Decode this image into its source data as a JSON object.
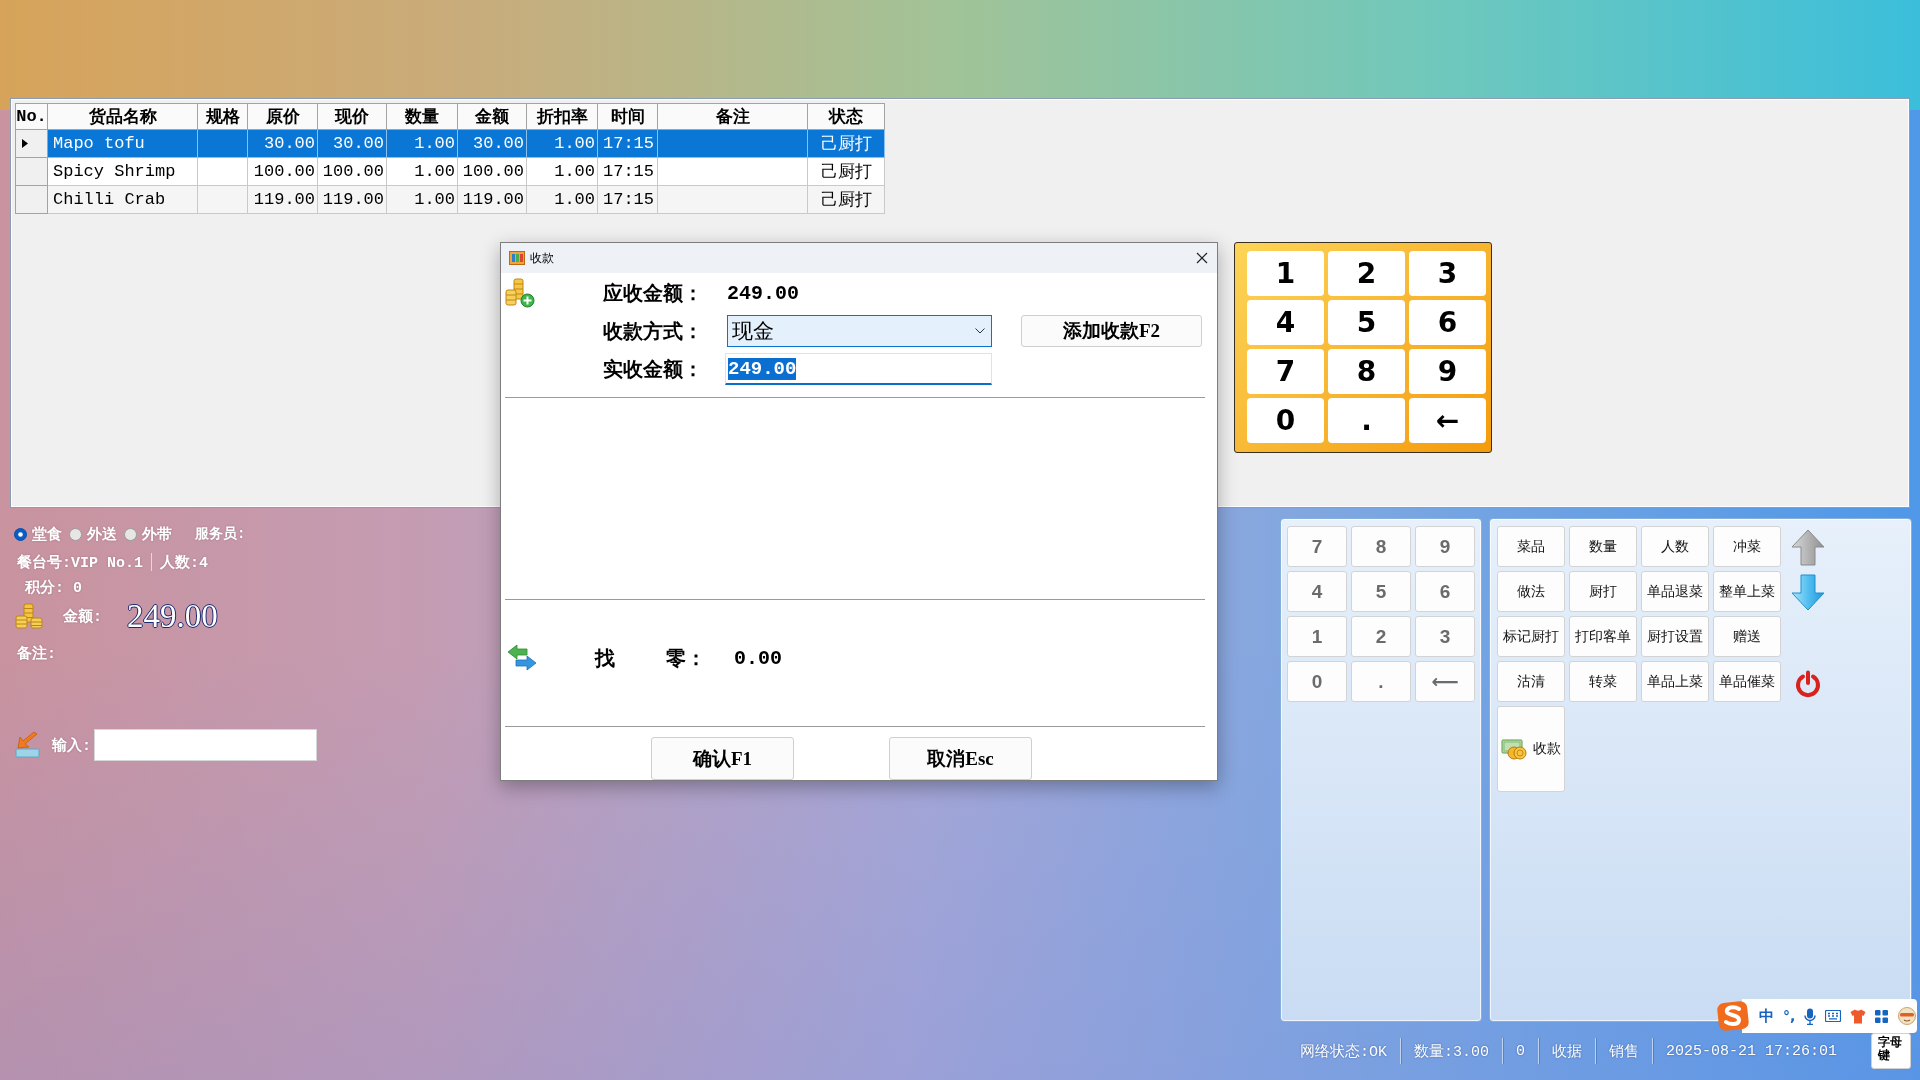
{
  "order_table": {
    "columns": [
      "No.",
      "货品名称",
      "规格",
      "原价",
      "现价",
      "数量",
      "金额",
      "折扣率",
      "时间",
      "备注",
      "状态"
    ],
    "rows": [
      {
        "selected": true,
        "name": "Mapo tofu",
        "original_price": "30.00",
        "current_price": "30.00",
        "quantity": "1.00",
        "amount": "30.00",
        "discount_rate": "1.00",
        "time": "17:15",
        "status": "己厨打"
      },
      {
        "selected": false,
        "name": "Spicy Shrimp",
        "original_price": "100.00",
        "current_price": "100.00",
        "quantity": "1.00",
        "amount": "100.00",
        "discount_rate": "1.00",
        "time": "17:15",
        "status": "己厨打"
      },
      {
        "selected": false,
        "name": "Chilli Crab",
        "original_price": "119.00",
        "current_price": "119.00",
        "quantity": "1.00",
        "amount": "119.00",
        "discount_rate": "1.00",
        "time": "17:15",
        "status": "己厨打"
      }
    ]
  },
  "payment_dialog": {
    "title": "收款",
    "amount_due": {
      "label": "应收金额：",
      "value": "249.00"
    },
    "payment_method": {
      "label": "收款方式：",
      "value": "现金"
    },
    "add_payment_button": "添加收款F2",
    "amount_received": {
      "label": "实收金额：",
      "value": "249.00",
      "text_selected": true
    },
    "change": {
      "label_parts": [
        "找",
        "零："
      ],
      "value": "0.00"
    },
    "buttons": [
      "确认F1",
      "取消Esc"
    ]
  },
  "quick_keypad": {
    "keys": [
      "1",
      "2",
      "3",
      "4",
      "5",
      "6",
      "7",
      "8",
      "9",
      "0",
      ".",
      "←"
    ]
  },
  "order_info": {
    "order_types": [
      {
        "label": "堂食",
        "selected": true
      },
      {
        "label": "外送",
        "selected": false
      },
      {
        "label": "外带",
        "selected": false
      }
    ],
    "waiter_label": "服务员:",
    "table_no": "餐台号:VIP No.1",
    "guest_count": "人数:4",
    "points": "积分: 0",
    "amount_label": "金额:",
    "amount_value": "249.00",
    "note_label": "备注:",
    "input_label": "输入:"
  },
  "number_pad": {
    "keys": [
      "7",
      "8",
      "9",
      "4",
      "5",
      "6",
      "1",
      "2",
      "3",
      "0",
      ".",
      "⟵"
    ]
  },
  "function_buttons": [
    "菜品",
    "数量",
    "人数",
    "冲菜",
    "做法",
    "厨打",
    "单品退菜",
    "整单上菜",
    "标记厨打",
    "打印客单",
    "厨打设置",
    "赠送",
    "沽清",
    "转菜",
    "单品上菜",
    "单品催菜"
  ],
  "checkout_button": "收款",
  "status_bar": [
    "网络状态:OK",
    "数量:3.00",
    "0",
    "收据",
    "销售",
    "2025-08-21 17:26:01"
  ],
  "input_method_bar": {
    "language": "中",
    "punctuation": "°,",
    "keyboard_mode": "字母键"
  }
}
